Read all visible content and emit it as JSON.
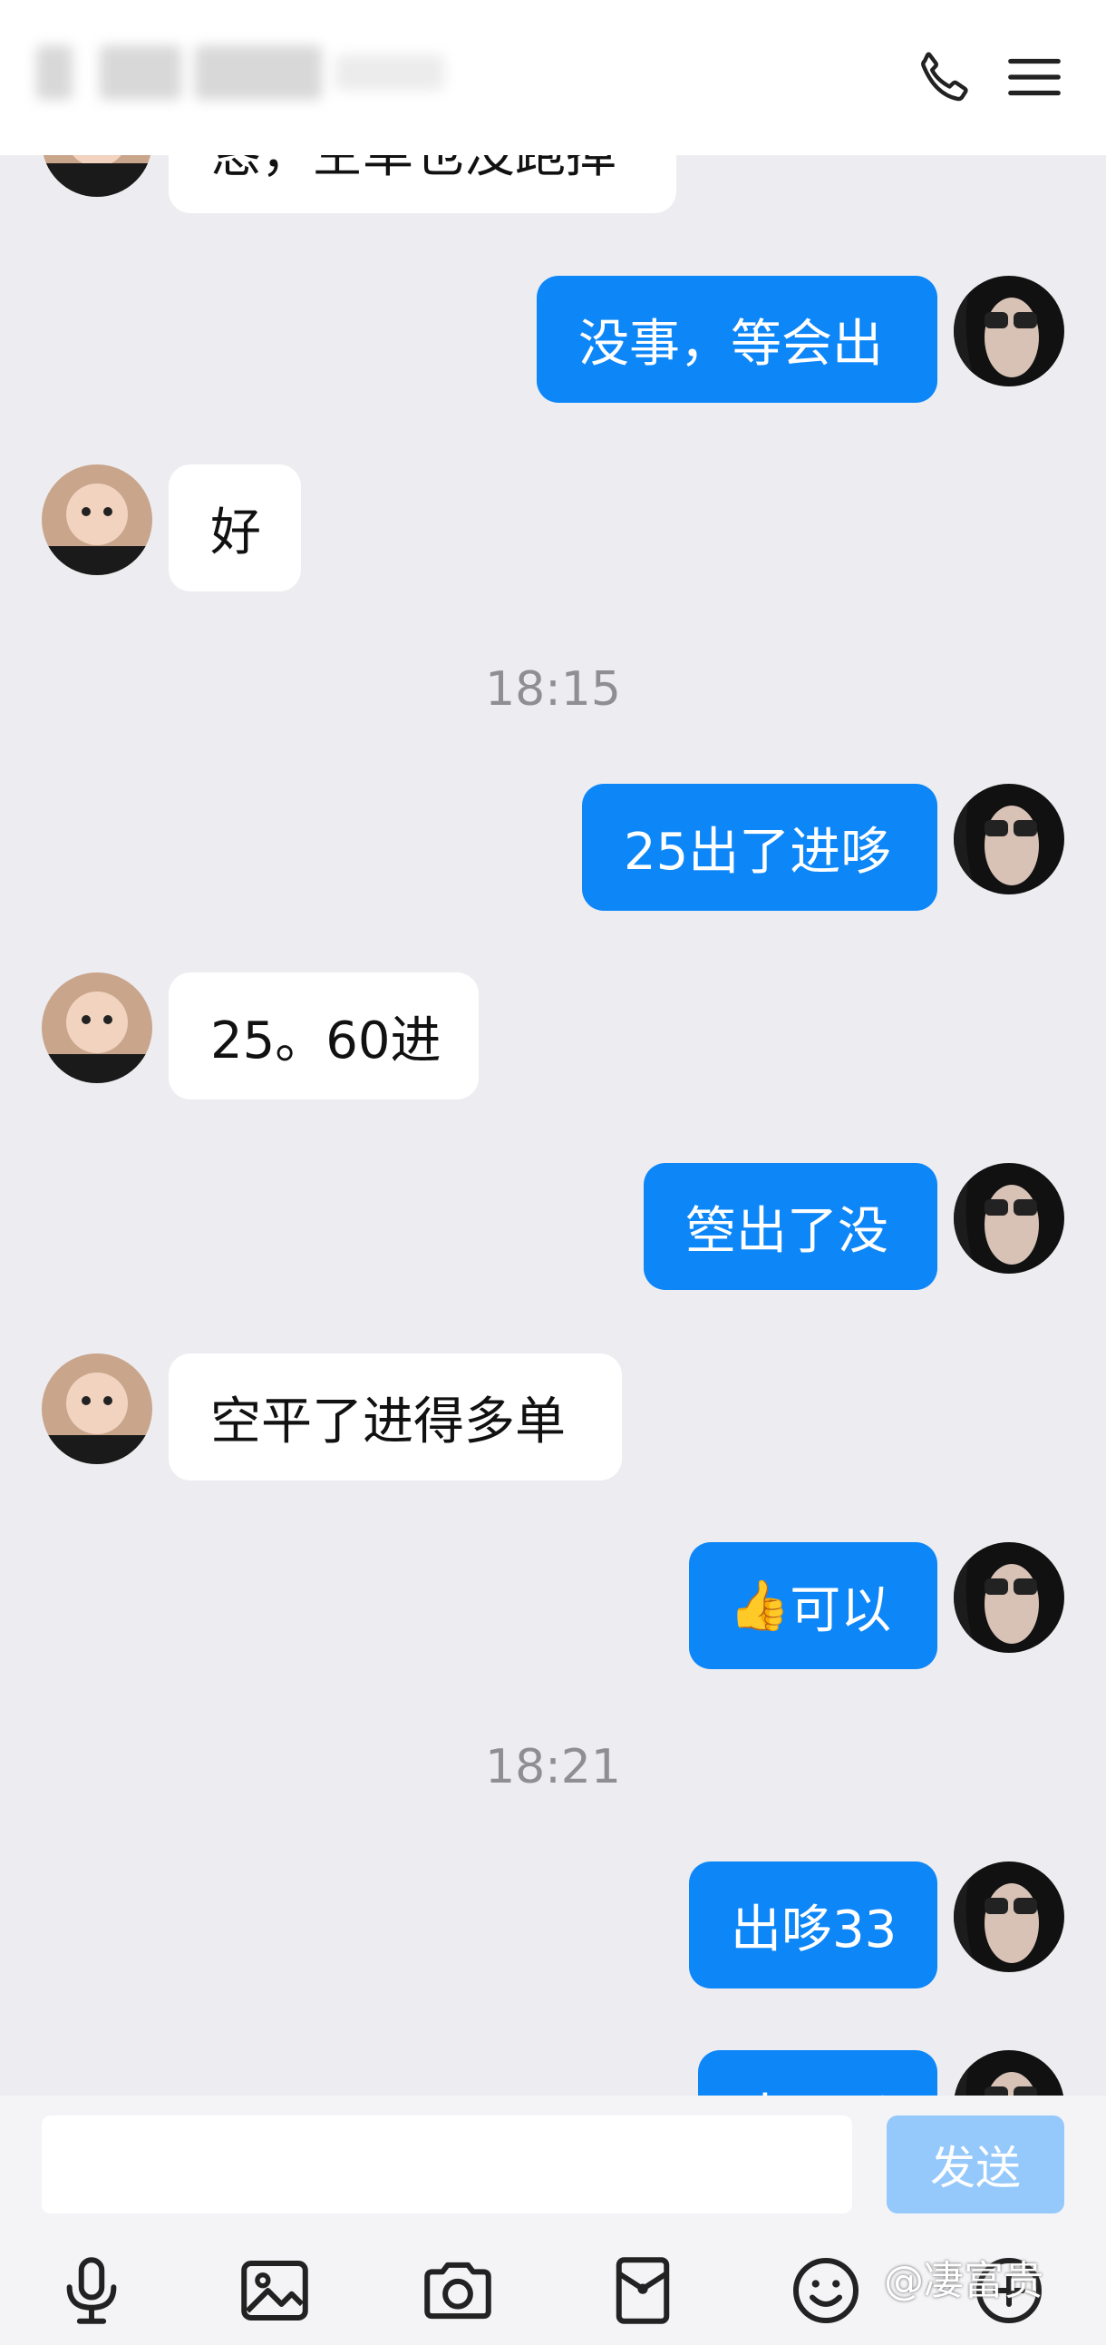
{
  "header": {
    "title": "(blurred contact name)"
  },
  "messages": {
    "m0": "恳，空单也没跑掉",
    "m1": "没事，等会出",
    "m2": "好",
    "t1": "18:15",
    "m3": "25出了进哆",
    "m4": "25。60进",
    "m5": "箜出了没",
    "m6": "空平了进得多单",
    "m7_emoji": "👍",
    "m7": "可以",
    "t2": "18:21",
    "m8": "出哆33",
    "m9": "出了吗"
  },
  "input": {
    "placeholder": "",
    "send_label": "发送"
  },
  "watermark": "@凄富贵",
  "colors": {
    "outgoing": "#0d86f8",
    "incoming": "#ffffff",
    "background": "#ededf1",
    "send_disabled": "#95c9fb"
  },
  "icons": [
    "phone-icon",
    "menu-icon",
    "mic-icon",
    "image-icon",
    "camera-icon",
    "red-packet-icon",
    "emoji-icon",
    "plus-icon"
  ]
}
